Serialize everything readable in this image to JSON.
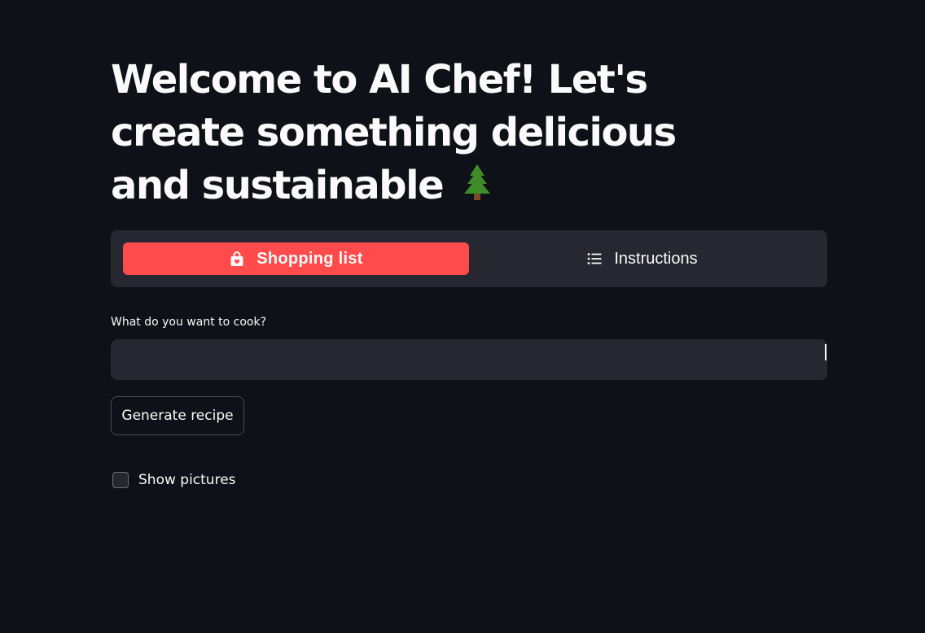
{
  "header": {
    "title": "Welcome to AI Chef! Let's create something delicious and sustainable",
    "title_icon": "evergreen-tree-icon"
  },
  "tabs": [
    {
      "label": "Shopping list",
      "icon": "shopping-bag-icon",
      "active": true
    },
    {
      "label": "Instructions",
      "icon": "list-icon",
      "active": false
    }
  ],
  "recipe_form": {
    "input_label": "What do you want to cook?",
    "input_value": "",
    "generate_button_label": "Generate recipe",
    "show_pictures_label": "Show pictures",
    "show_pictures_checked": false
  },
  "colors": {
    "background": "#0e1117",
    "surface": "#262730",
    "accent": "#ff4b4b",
    "text": "#fafafa",
    "tree_green": "#3e8b2a",
    "tree_trunk": "#7a4a2a"
  }
}
